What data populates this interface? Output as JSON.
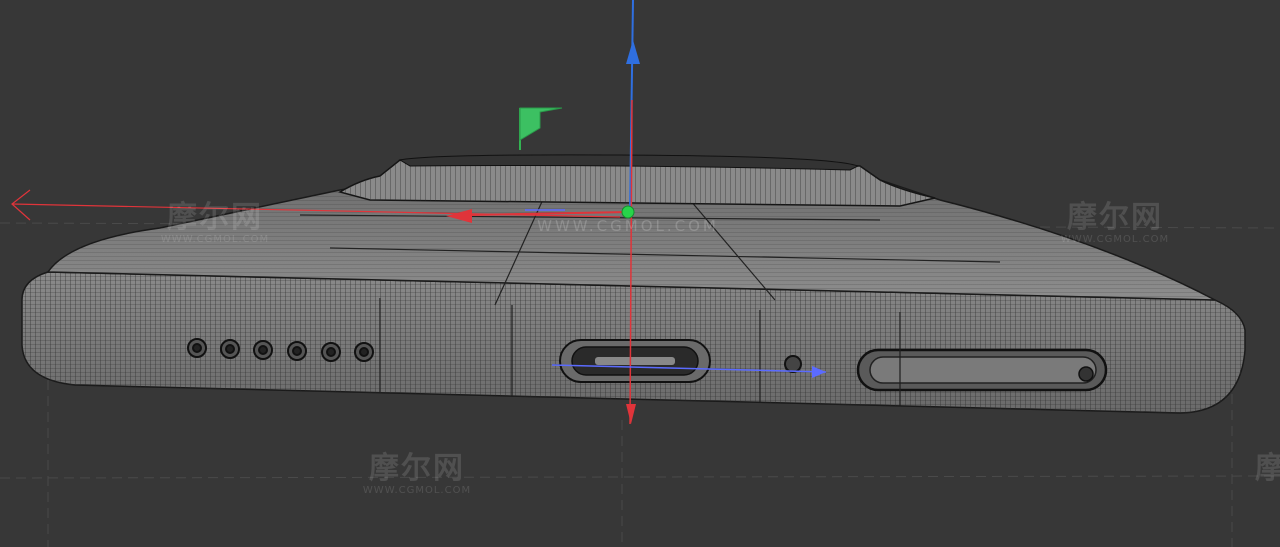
{
  "viewport": {
    "background": "#373737",
    "model_fill": "#7c7c7c",
    "wire_color": "#1e1e1e",
    "axis_colors": {
      "x": "#e0343a",
      "y": "#33b352",
      "z": "#2f6fe0"
    }
  },
  "gizmo": {
    "x_handle": "x-axis-arrow-icon",
    "y_handle": "y-axis-plane-flag-icon",
    "z_handle": "z-axis-arrow-icon",
    "pivot": "pivot-point-icon"
  },
  "watermarks": [
    {
      "title": "摩尔网",
      "url": "WWW.CGMOL.COM"
    },
    {
      "title": "摩尔网",
      "url": "WWW.CGMOL.COM"
    },
    {
      "title": "摩尔网",
      "url": "WWW.CGMOL.COM"
    },
    {
      "title": "摩尔网",
      "url": ""
    }
  ],
  "center_watermark": "WWW.CGMOL.COM"
}
